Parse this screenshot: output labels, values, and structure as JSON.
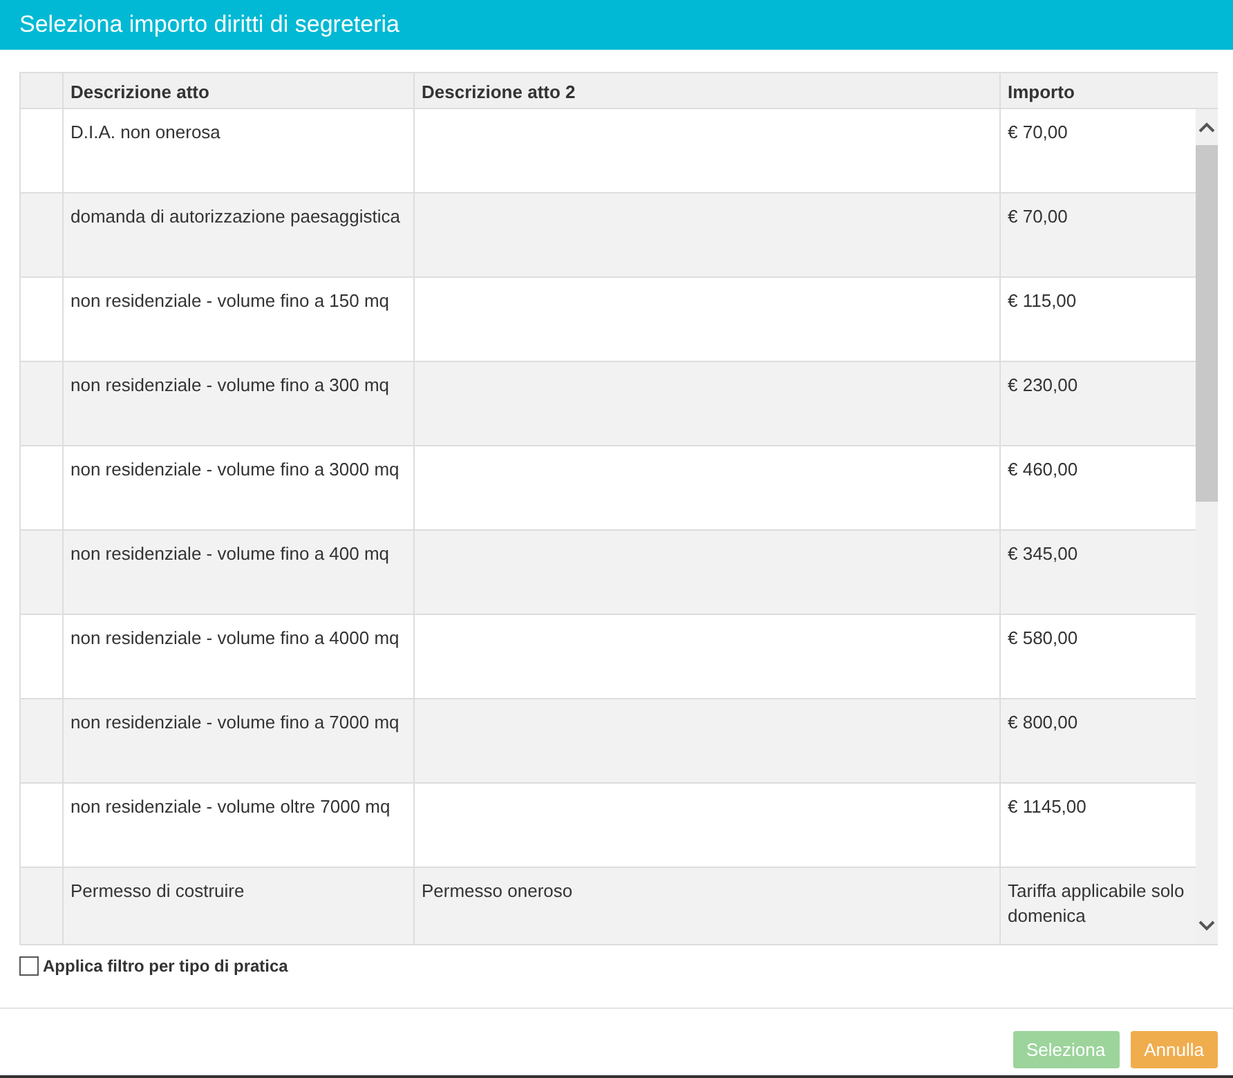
{
  "window": {
    "title": "Seleziona importo diritti di segreteria"
  },
  "table": {
    "columns": [
      "Descrizione atto",
      "Descrizione atto 2",
      "Importo"
    ],
    "rows": [
      {
        "descrizione": "D.I.A. non onerosa",
        "descrizione_2": "",
        "importo": "€ 70,00",
        "selected": false
      },
      {
        "descrizione": "domanda di autorizzazione paesaggistica",
        "descrizione_2": "",
        "importo": "€ 70,00",
        "selected": false
      },
      {
        "descrizione": "non residenziale - volume fino a 150 mq",
        "descrizione_2": "",
        "importo": "€ 115,00",
        "selected": false
      },
      {
        "descrizione": "non residenziale - volume fino a 300 mq",
        "descrizione_2": "",
        "importo": "€ 230,00",
        "selected": false
      },
      {
        "descrizione": "non residenziale - volume fino a 3000 mq",
        "descrizione_2": "",
        "importo": "€ 460,00",
        "selected": false
      },
      {
        "descrizione": "non residenziale - volume fino a 400 mq",
        "descrizione_2": "",
        "importo": "€ 345,00",
        "selected": false
      },
      {
        "descrizione": "non residenziale - volume fino a 4000 mq",
        "descrizione_2": "",
        "importo": "€ 580,00",
        "selected": false
      },
      {
        "descrizione": "non residenziale - volume fino a 7000 mq",
        "descrizione_2": "",
        "importo": "€ 800,00",
        "selected": false
      },
      {
        "descrizione": "non residenziale - volume oltre 7000 mq",
        "descrizione_2": "",
        "importo": "€ 1145,00",
        "selected": false
      },
      {
        "descrizione": "Permesso di costruire",
        "descrizione_2": "Permesso oneroso",
        "importo": "Tariffa applicabile solo domenica",
        "selected": false
      }
    ]
  },
  "filter": {
    "label": "Applica filtro per tipo di pratica",
    "checked": false
  },
  "buttons": [
    {
      "label": "Seleziona",
      "kind": "primary",
      "disabled": true
    },
    {
      "label": "Annulla",
      "kind": "cancel",
      "disabled": false
    }
  ]
}
